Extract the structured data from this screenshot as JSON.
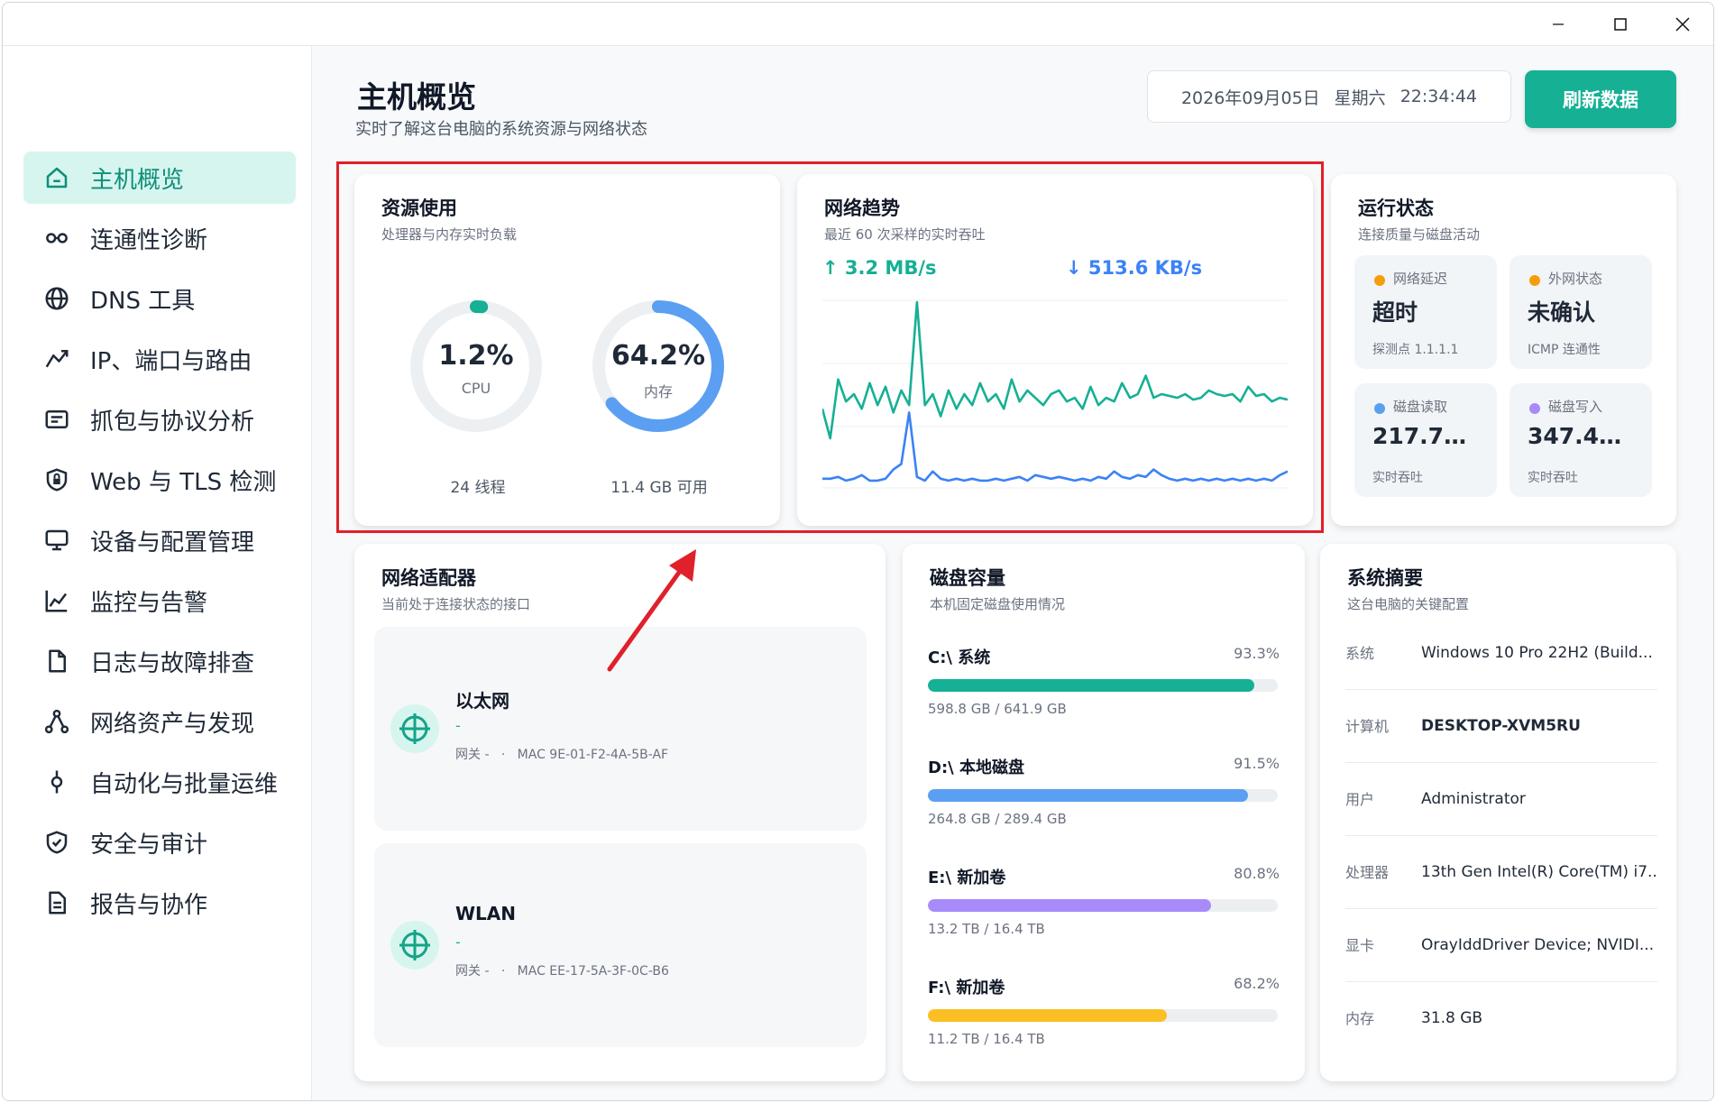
{
  "page": {
    "title": "主机概览",
    "subtitle": "实时了解这台电脑的系统资源与网络状态",
    "date": "2026年09月05日",
    "weekday": "星期六",
    "time": "22:34:44",
    "refresh_label": "刷新数据"
  },
  "sidebar": {
    "items": [
      {
        "label": "主机概览",
        "icon": "home-icon"
      },
      {
        "label": "连通性诊断",
        "icon": "link-icon"
      },
      {
        "label": "DNS 工具",
        "icon": "globe-icon"
      },
      {
        "label": "IP、端口与路由",
        "icon": "route-icon"
      },
      {
        "label": "抓包与协议分析",
        "icon": "packet-icon"
      },
      {
        "label": "Web 与 TLS 检测",
        "icon": "shield-lock-icon"
      },
      {
        "label": "设备与配置管理",
        "icon": "monitor-icon"
      },
      {
        "label": "监控与告警",
        "icon": "line-chart-icon"
      },
      {
        "label": "日志与故障排查",
        "icon": "document-icon"
      },
      {
        "label": "网络资产与发现",
        "icon": "network-nodes-icon"
      },
      {
        "label": "自动化与批量运维",
        "icon": "automation-icon"
      },
      {
        "label": "安全与审计",
        "icon": "shield-check-icon"
      },
      {
        "label": "报告与协作",
        "icon": "report-icon"
      }
    ]
  },
  "resource": {
    "title": "资源使用",
    "subtitle": "处理器与内存实时负载",
    "cpu": {
      "value": "1.2%",
      "label": "CPU",
      "foot": "24 线程",
      "fraction": 0.012,
      "color": "#16b094"
    },
    "memory": {
      "value": "64.2%",
      "label": "内存",
      "foot": "11.4 GB 可用",
      "fraction": 0.642,
      "color": "#5b9ff2"
    }
  },
  "network_trend": {
    "title": "网络趋势",
    "subtitle": "最近 60 次采样的实时吞吐",
    "up": "↑ 3.2 MB/s",
    "down": "↓ 513.6 KB/s",
    "up_color": "#16b094",
    "down_color": "#3b82f6",
    "upload_series": [
      0.42,
      0.26,
      0.58,
      0.46,
      0.5,
      0.42,
      0.56,
      0.44,
      0.54,
      0.4,
      0.52,
      0.44,
      1.0,
      0.44,
      0.5,
      0.38,
      0.52,
      0.42,
      0.5,
      0.44,
      0.56,
      0.46,
      0.5,
      0.42,
      0.58,
      0.46,
      0.52,
      0.48,
      0.44,
      0.5,
      0.52,
      0.46,
      0.48,
      0.42,
      0.54,
      0.44,
      0.48,
      0.46,
      0.56,
      0.48,
      0.5,
      0.6,
      0.48,
      0.5,
      0.49,
      0.48,
      0.5,
      0.47,
      0.48,
      0.52,
      0.5,
      0.49,
      0.5,
      0.46,
      0.54,
      0.49,
      0.5,
      0.46,
      0.48,
      0.47
    ],
    "download_series": [
      0.04,
      0.04,
      0.05,
      0.03,
      0.04,
      0.06,
      0.03,
      0.03,
      0.04,
      0.09,
      0.12,
      0.4,
      0.05,
      0.03,
      0.08,
      0.04,
      0.03,
      0.04,
      0.03,
      0.04,
      0.03,
      0.03,
      0.04,
      0.03,
      0.04,
      0.05,
      0.03,
      0.06,
      0.05,
      0.04,
      0.05,
      0.04,
      0.03,
      0.04,
      0.03,
      0.05,
      0.04,
      0.08,
      0.05,
      0.04,
      0.06,
      0.05,
      0.09,
      0.06,
      0.04,
      0.03,
      0.04,
      0.03,
      0.04,
      0.03,
      0.04,
      0.03,
      0.04,
      0.03,
      0.04,
      0.03,
      0.04,
      0.03,
      0.06,
      0.08
    ]
  },
  "run_state": {
    "title": "运行状态",
    "subtitle": "连接质量与磁盘活动",
    "tiles": [
      {
        "label": "网络延迟",
        "value": "超时",
        "sub": "探测点 1.1.1.1",
        "dot": "#f59e0b"
      },
      {
        "label": "外网状态",
        "value": "未确认",
        "sub": "ICMP 连通性",
        "dot": "#f59e0b"
      },
      {
        "label": "磁盘读取",
        "value": "217.7…",
        "sub": "实时吞吐",
        "dot": "#5b9ff2"
      },
      {
        "label": "磁盘写入",
        "value": "347.4…",
        "sub": "实时吞吐",
        "dot": "#a78bfa"
      }
    ]
  },
  "adapters": {
    "title": "网络适配器",
    "subtitle": "当前处于连接状态的接口",
    "items": [
      {
        "name": "以太网",
        "dash": "-",
        "info": "网关 -   ·   MAC 9E-01-F2-4A-5B-AF"
      },
      {
        "name": "WLAN",
        "dash": "-",
        "info": "网关 -   ·   MAC EE-17-5A-3F-0C-B6"
      }
    ]
  },
  "disks": {
    "title": "磁盘容量",
    "subtitle": "本机固定磁盘使用情况",
    "items": [
      {
        "name": "C:\\ 系统",
        "pct": "93.3%",
        "fraction": 0.933,
        "size": "598.8 GB / 641.9 GB",
        "color": "#16b094"
      },
      {
        "name": "D:\\ 本地磁盘",
        "pct": "91.5%",
        "fraction": 0.915,
        "size": "264.8 GB / 289.4 GB",
        "color": "#5b9ff2"
      },
      {
        "name": "E:\\ 新加卷",
        "pct": "80.8%",
        "fraction": 0.808,
        "size": "13.2 TB / 16.4 TB",
        "color": "#a78bfa"
      },
      {
        "name": "F:\\ 新加卷",
        "pct": "68.2%",
        "fraction": 0.682,
        "size": "11.2 TB / 16.4 TB",
        "color": "#fbbf24"
      }
    ]
  },
  "summary": {
    "title": "系统摘要",
    "subtitle": "这台电脑的关键配置",
    "rows": [
      {
        "k": "系统",
        "v": "Windows 10 Pro 22H2 (Build..."
      },
      {
        "k": "计算机",
        "v": "DESKTOP-XVM5RU"
      },
      {
        "k": "用户",
        "v": "Administrator"
      },
      {
        "k": "处理器",
        "v": "13th Gen Intel(R) Core(TM) i7..."
      },
      {
        "k": "显卡",
        "v": "OrayIddDriver Device; NVIDI..."
      },
      {
        "k": "内存",
        "v": "31.8 GB"
      }
    ]
  },
  "colors": {
    "accent": "#16b094",
    "highlight": "#e0202a"
  }
}
